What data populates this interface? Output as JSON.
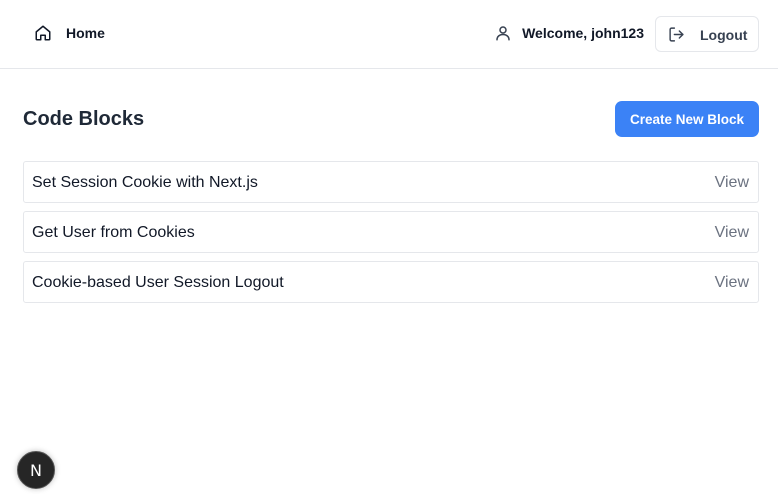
{
  "header": {
    "home_label": "Home",
    "welcome_text": "Welcome, john123",
    "logout_label": "Logout"
  },
  "main": {
    "title": "Code Blocks",
    "create_button_label": "Create New Block",
    "blocks": [
      {
        "title": "Set Session Cookie with Next.js",
        "action": "View"
      },
      {
        "title": "Get User from Cookies",
        "action": "View"
      },
      {
        "title": "Cookie-based User Session Logout",
        "action": "View"
      }
    ]
  },
  "dev_badge": {
    "glyph": "N",
    "icon": "nextjs-logo-icon"
  },
  "colors": {
    "accent": "#3b82f6",
    "border": "#e5e7eb",
    "muted_text": "#6b7280",
    "badge_bg": "#262626"
  },
  "icons": {
    "home": "home-icon",
    "user": "user-icon",
    "logout": "logout-icon"
  }
}
